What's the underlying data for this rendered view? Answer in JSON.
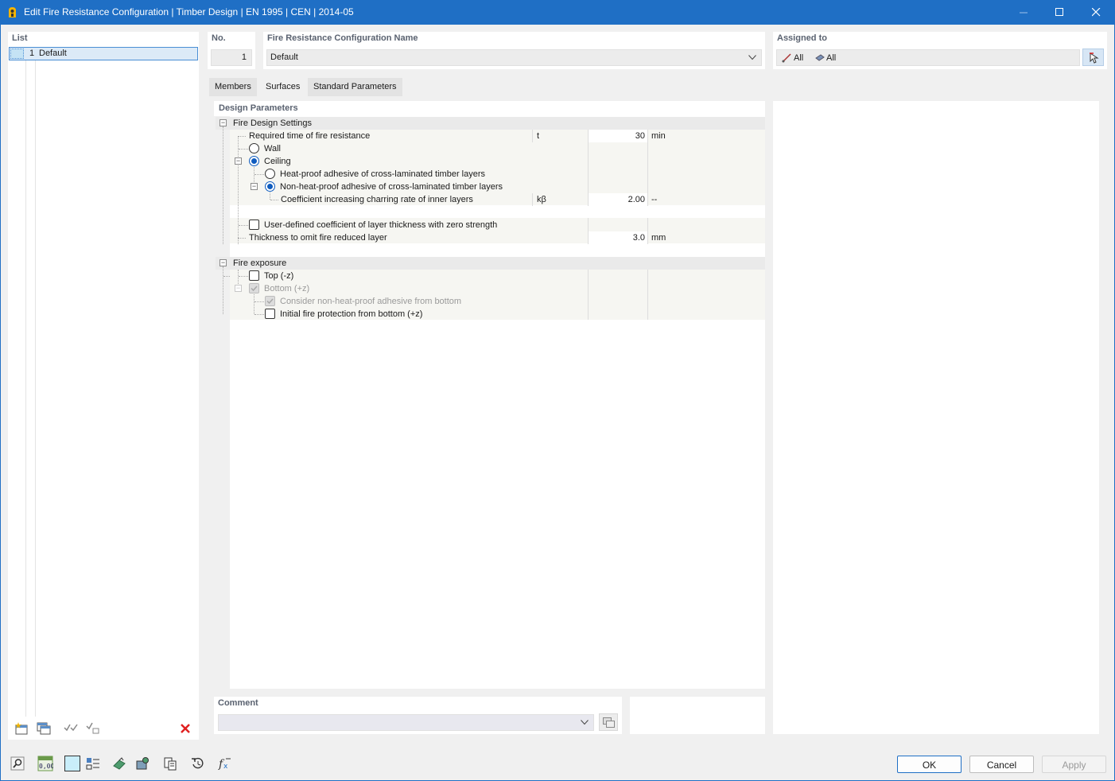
{
  "window": {
    "title": "Edit Fire Resistance Configuration | Timber Design | EN 1995 | CEN | 2014-05"
  },
  "list": {
    "label": "List",
    "items": [
      {
        "num": "1",
        "name": "Default"
      }
    ]
  },
  "header": {
    "no_label": "No.",
    "no_value": "1",
    "name_label": "Fire Resistance Configuration Name",
    "name_value": "Default",
    "assigned_label": "Assigned to",
    "assigned_members": "All",
    "assigned_surfaces": "All"
  },
  "tabs": [
    {
      "label": "Members",
      "active": false
    },
    {
      "label": "Surfaces",
      "active": true
    },
    {
      "label": "Standard Parameters",
      "active": false
    }
  ],
  "design": {
    "section_label": "Design Parameters",
    "fire_design_settings": "Fire Design Settings",
    "required_time_label": "Required time of fire resistance",
    "required_time_symbol": "t",
    "required_time_value": "30",
    "required_time_unit": "min",
    "wall_label": "Wall",
    "wall_selected": false,
    "ceiling_label": "Ceiling",
    "ceiling_selected": true,
    "heat_proof_label": "Heat-proof adhesive of cross-laminated timber layers",
    "heat_proof_selected": false,
    "non_heat_proof_label": "Non-heat-proof adhesive of cross-laminated timber layers",
    "non_heat_proof_selected": true,
    "coef_label": "Coefficient increasing charring rate of inner layers",
    "coef_symbol": "kβ",
    "coef_value": "2.00",
    "coef_unit": "--",
    "user_defined_label": "User-defined coefficient of layer thickness with zero strength",
    "user_defined_checked": false,
    "thickness_label": "Thickness to omit fire reduced layer",
    "thickness_value": "3.0",
    "thickness_unit": "mm",
    "fire_exposure": "Fire exposure",
    "top_label": "Top (-z)",
    "top_checked": false,
    "bottom_label": "Bottom (+z)",
    "bottom_checked": true,
    "consider_label": "Consider non-heat-proof adhesive from bottom",
    "consider_checked": true,
    "initial_label": "Initial fire protection from bottom (+z)",
    "initial_checked": false
  },
  "comment": {
    "label": "Comment",
    "value": ""
  },
  "buttons": {
    "ok": "OK",
    "cancel": "Cancel",
    "apply": "Apply"
  },
  "colors": {
    "accent": "#1f6fc5",
    "radio_selected": "#0f5cbf",
    "delete": "#e02020"
  }
}
